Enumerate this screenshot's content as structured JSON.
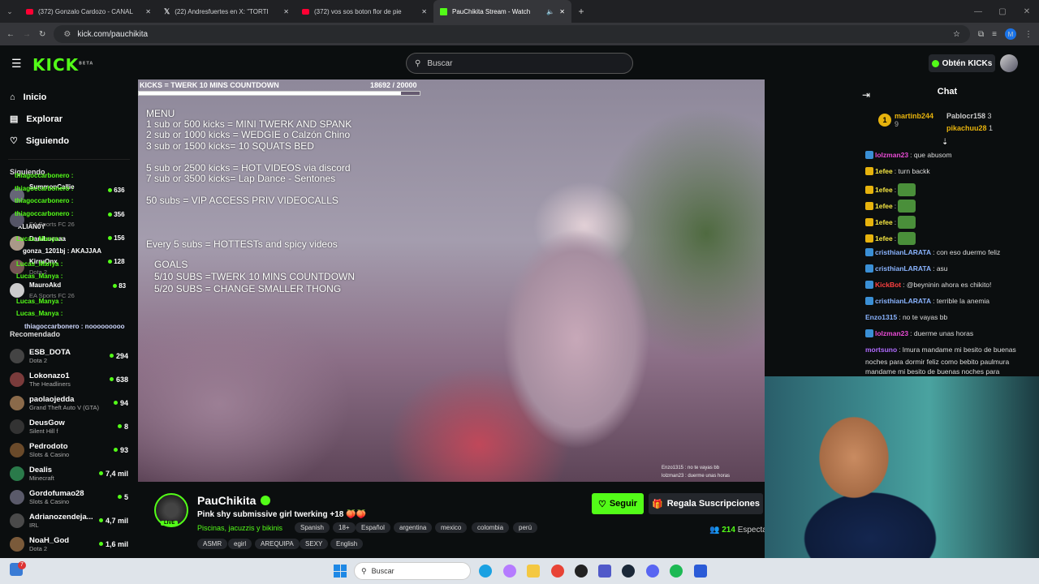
{
  "browser": {
    "tabs": [
      {
        "title": "(372) Gonzalo Cardozo - CANAL",
        "icon": "youtube-icon"
      },
      {
        "title": "(22) Andresfuertes en X: \"TORTI",
        "icon": "x-icon"
      },
      {
        "title": "(372) vos sos boton flor de pie",
        "icon": "youtube-icon"
      },
      {
        "title": "PauChikita Stream - Watch",
        "icon": "kick-icon"
      }
    ],
    "url": "kick.com/pauchikita",
    "profile_initial": "M"
  },
  "header": {
    "logo": "KICK",
    "logo_sup": "BETA",
    "search_placeholder": "Buscar",
    "get_kicks": "Obtén KICKs"
  },
  "sidebar": {
    "nav": [
      {
        "label": "Inicio",
        "icon": "home-icon"
      },
      {
        "label": "Explorar",
        "icon": "explore-icon"
      },
      {
        "label": "Siguiendo",
        "icon": "heart-icon"
      }
    ],
    "following_title": "Siguiendo",
    "following": [
      {
        "name": "SummonCallie",
        "viewers": "636"
      },
      {
        "name": "XLIAN0Y",
        "viewers": "356"
      },
      {
        "name": "DaniLucaaa",
        "viewers": "156"
      },
      {
        "name": "KirruOnx",
        "viewers": "128"
      },
      {
        "name": "MauroAkd",
        "viewers": "83"
      }
    ],
    "overlay_lines": [
      "thiagoccarbonero :",
      "thiagoccarbonero :",
      "thiagoccarbonero :",
      "thiagoccarbonero :",
      "Lucas_Manya :",
      "gonza_1201bj : AKAJJAA",
      "Lucas_Manya :",
      "Lucas_Manya :",
      "Lucas_Manya :",
      "Lucas_Manya :",
      "thiagoccarbonero : nooooooooo",
      "EA Sports FC 26",
      "EA Sports FC 26",
      "Dota 2"
    ],
    "recommended_title": "Recomendado",
    "recommended": [
      {
        "name": "ESB_DOTA",
        "game": "Dota 2",
        "viewers": "294",
        "color": "#444"
      },
      {
        "name": "Lokonazo1",
        "game": "The Headliners",
        "viewers": "638",
        "color": "#7a3b3b"
      },
      {
        "name": "paolaojedda",
        "game": "Grand Theft Auto V (GTA)",
        "viewers": "94",
        "color": "#8a6a4a"
      },
      {
        "name": "DeusGow",
        "game": "Silent Hill f",
        "viewers": "8",
        "color": "#333"
      },
      {
        "name": "Pedrodoto",
        "game": "Slots & Casino",
        "viewers": "93",
        "color": "#6a4a2a"
      },
      {
        "name": "Dealis",
        "game": "Minecraft",
        "viewers": "7,4 mil",
        "color": "#2a7a4a"
      },
      {
        "name": "Gordofumao28",
        "game": "Slots & Casino",
        "viewers": "5",
        "color": "#5a5a6a"
      },
      {
        "name": "Adrianozendeja...",
        "game": "IRL",
        "viewers": "4,7 mil",
        "color": "#4a4a4a"
      },
      {
        "name": "NoaH_God",
        "game": "Dota 2",
        "viewers": "1,6 mil",
        "color": "#7a5a3a"
      }
    ]
  },
  "video": {
    "goal_text": "KICKS = TWERK 10 MINS COUNTDOWN",
    "goal_count": "18692 / 20000",
    "goal_progress": 0.9346,
    "menu": [
      "MENU",
      "1 sub or 500 kicks = MINI TWERK AND SPANK",
      "2 sub or 1000 kicks = WEDGIE o Calzón Chino",
      "3 sub or 1500 kicks= 10 SQUATS BED",
      "",
      "5 sub or 2500 kicks = HOT VIDEOS via discord",
      "7 sub or 3500 kicks= Lap Dance - Sentones",
      "",
      "50 subs = VIP ACCESS PRIV VIDEOCALLS"
    ],
    "every5": "Every 5 subs = HOTTESTs and spicy videos",
    "goals": [
      "GOALS",
      "5/10 SUBS =TWERK 10 MINS COUNTDOWN",
      "5/20 SUBS = CHANGE SMALLER THONG"
    ],
    "mini_chat": [
      "Enzo1315 : no te vayas bb",
      "lolzman23 : duerme unas horas"
    ]
  },
  "channel": {
    "name": "PauChikita",
    "live_label": "LIVE",
    "title": "Pink shy submissive girl twerking +18 🍑🍑",
    "category": "Piscinas, jacuzzis y bikinis",
    "tags_row1": [
      "Spanish",
      "18+",
      "Español",
      "argentina",
      "mexico",
      "colombia",
      "perú"
    ],
    "tags_row2": [
      "ASMR",
      "egirl",
      "AREQUIPA",
      "SEXY",
      "English"
    ],
    "follow_label": "Seguir",
    "gift_label": "Regala Suscripciones",
    "viewers": "214",
    "viewers_label": "Especta"
  },
  "chat": {
    "title": "Chat",
    "leaders": [
      {
        "rank": "1",
        "name": "martinb244",
        "count": "9"
      },
      {
        "name": "Pablocr158",
        "count": "3"
      },
      {
        "name": "pikachuu28",
        "count": "1"
      }
    ],
    "messages": [
      {
        "user": "lolzman23",
        "text": ": que abusom",
        "color": "#e94bd5"
      },
      {
        "user": "1efee",
        "text": ": turn backk",
        "color": "#f5e642"
      },
      {
        "user": "1efee",
        "text": ":",
        "color": "#f5e642"
      },
      {
        "user": "1efee",
        "text": ":",
        "color": "#f5e642"
      },
      {
        "user": "1efee",
        "text": ":",
        "color": "#f5e642"
      },
      {
        "user": "1efee",
        "text": ":",
        "color": "#f5e642"
      },
      {
        "user": "cristhianLARATA",
        "text": ": con eso duermo feliz",
        "color": "#8ab4ff"
      },
      {
        "user": "cristhianLARATA",
        "text": ": asu",
        "color": "#8ab4ff"
      },
      {
        "user": "KickBot",
        "text": ": @beyninin ahora es chikito!",
        "color": "#ff4040"
      },
      {
        "user": "cristhianLARATA",
        "text": ": terrible la anemia",
        "color": "#8ab4ff"
      },
      {
        "user": "Enzo1315",
        "text": ": no te vayas bb",
        "color": "#8ab4ff"
      },
      {
        "user": "lolzman23",
        "text": ": duerme unas horas",
        "color": "#e94bd5"
      },
      {
        "user": "mortsuno",
        "text": ": lmura mandame mi besito de buenas",
        "color": "#b06bff"
      }
    ],
    "wrap1": "noches para dormir feliz como bebito paulmura",
    "wrap2": "mandame mi besito de buenas noches para"
  },
  "taskbar": {
    "search_placeholder": "Buscar",
    "notif_count": "7"
  }
}
